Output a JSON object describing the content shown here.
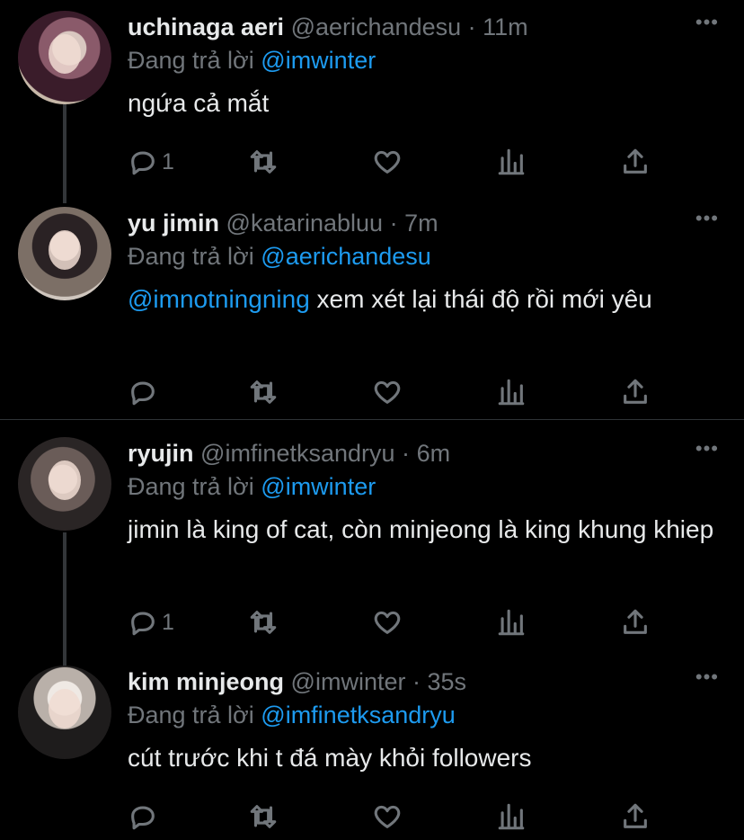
{
  "tweets": [
    {
      "name": "uchinaga aeri",
      "handle": "@aerichandesu",
      "dot": "·",
      "time": "11m",
      "reply_prefix": "Đang trả lời",
      "reply_to": "@imwinter",
      "text": "ngứa cả mắt",
      "text_mention": "",
      "reply_count": "1",
      "more": "•••"
    },
    {
      "name": "yu jimin",
      "handle": "@katarinabluu",
      "dot": "·",
      "time": "7m",
      "reply_prefix": "Đang trả lời",
      "reply_to": "@aerichandesu",
      "text_mention": "@imnotningning",
      "text": " xem xét lại thái độ rồi mới yêu",
      "reply_count": "",
      "more": "•••"
    },
    {
      "name": "ryujin",
      "handle": "@imfinetksandryu",
      "dot": "·",
      "time": "6m",
      "reply_prefix": "Đang trả lời",
      "reply_to": "@imwinter",
      "text_mention": "",
      "text": "jimin là king of cat, còn minjeong là king khung khiep",
      "reply_count": "1",
      "more": "•••"
    },
    {
      "name": "kim minjeong",
      "handle": "@imwinter",
      "dot": "·",
      "time": "35s",
      "reply_prefix": "Đang trả lời",
      "reply_to": "@imfinetksandryu",
      "text_mention": "",
      "text": "cút trước khi t đá mày khỏi followers",
      "reply_count": "",
      "more": "•••"
    }
  ],
  "icons": {
    "reply": "reply-icon",
    "retweet": "retweet-icon",
    "like": "heart-icon",
    "analytics": "analytics-icon",
    "share": "share-icon",
    "more": "more-icon"
  },
  "colors": {
    "background": "#000000",
    "text": "#e7e9ea",
    "secondary": "#71767b",
    "accent": "#1d9bf0",
    "thread_line": "#333639"
  }
}
